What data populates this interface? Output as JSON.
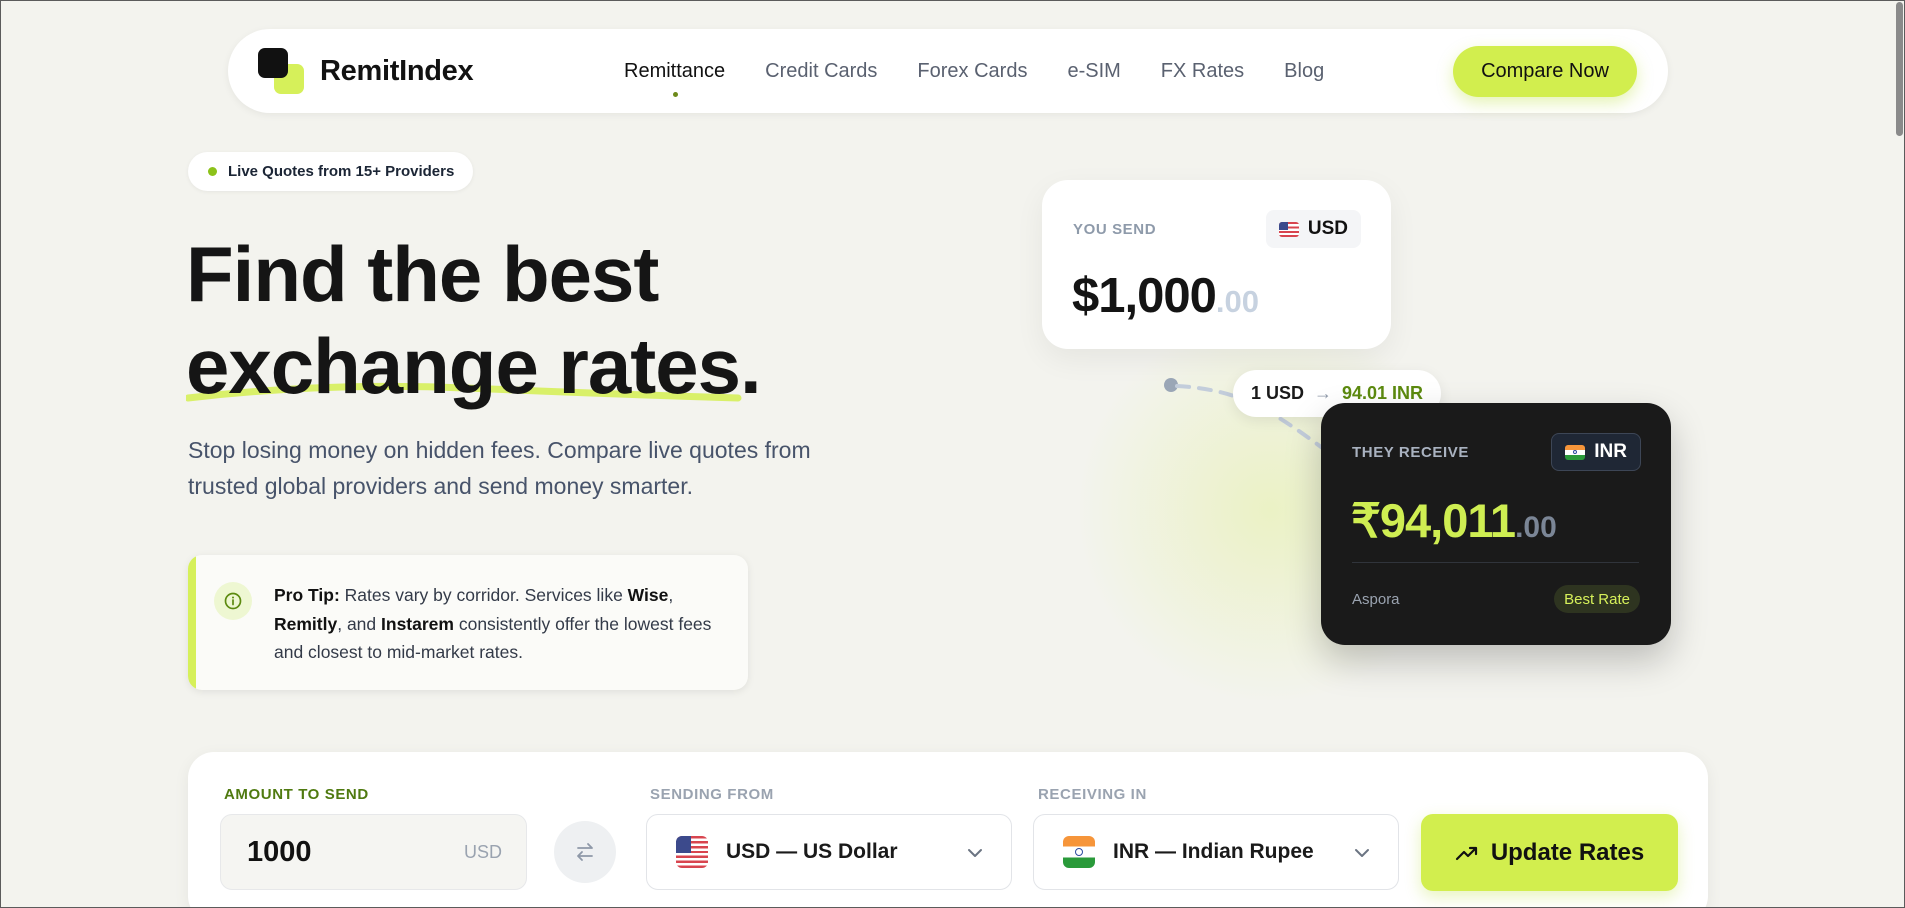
{
  "brand": {
    "name": "RemitIndex"
  },
  "nav": {
    "items": [
      {
        "label": "Remittance",
        "active": true
      },
      {
        "label": "Credit Cards",
        "active": false
      },
      {
        "label": "Forex Cards",
        "active": false
      },
      {
        "label": "e-SIM",
        "active": false
      },
      {
        "label": "FX Rates",
        "active": false
      },
      {
        "label": "Blog",
        "active": false
      }
    ],
    "cta_label": "Compare Now"
  },
  "hero": {
    "badge": "Live Quotes from 15+ Providers",
    "headline_line1": "Find the best",
    "headline_line2": "exchange rates.",
    "subtitle": "Stop losing money on hidden fees. Compare live quotes from trusted global providers and send money smarter."
  },
  "tip": {
    "label": "Pro Tip:",
    "text_1": " Rates vary by corridor. Services like ",
    "provider_1": "Wise",
    "text_2": ", ",
    "provider_2": "Remitly",
    "text_3": ", and ",
    "provider_3": "Instarem",
    "text_4": " consistently offer the lowest fees and closest to mid-market rates."
  },
  "send_card": {
    "label": "YOU SEND",
    "currency": "USD",
    "amount_whole": "$1,000",
    "amount_cents": ".00"
  },
  "rate_pill": {
    "from": "1 USD",
    "arrow": "→",
    "to": "94.01 INR"
  },
  "receive_card": {
    "label": "THEY RECEIVE",
    "currency": "INR",
    "amount_whole": "₹94,011",
    "amount_cents": ".00",
    "provider": "Aspora",
    "badge": "Best Rate"
  },
  "converter": {
    "amount_label": "AMOUNT TO SEND",
    "amount_value": "1000",
    "amount_unit": "USD",
    "from_label": "SENDING FROM",
    "from_value": "USD — US Dollar",
    "to_label": "RECEIVING IN",
    "to_value": "INR — Indian Rupee",
    "update_label": "Update Rates"
  },
  "colors": {
    "accent": "#d2ee4e",
    "accent_dark": "#5c8a0f",
    "background": "#f3f3ee",
    "dark_card": "#1a1a1a"
  }
}
